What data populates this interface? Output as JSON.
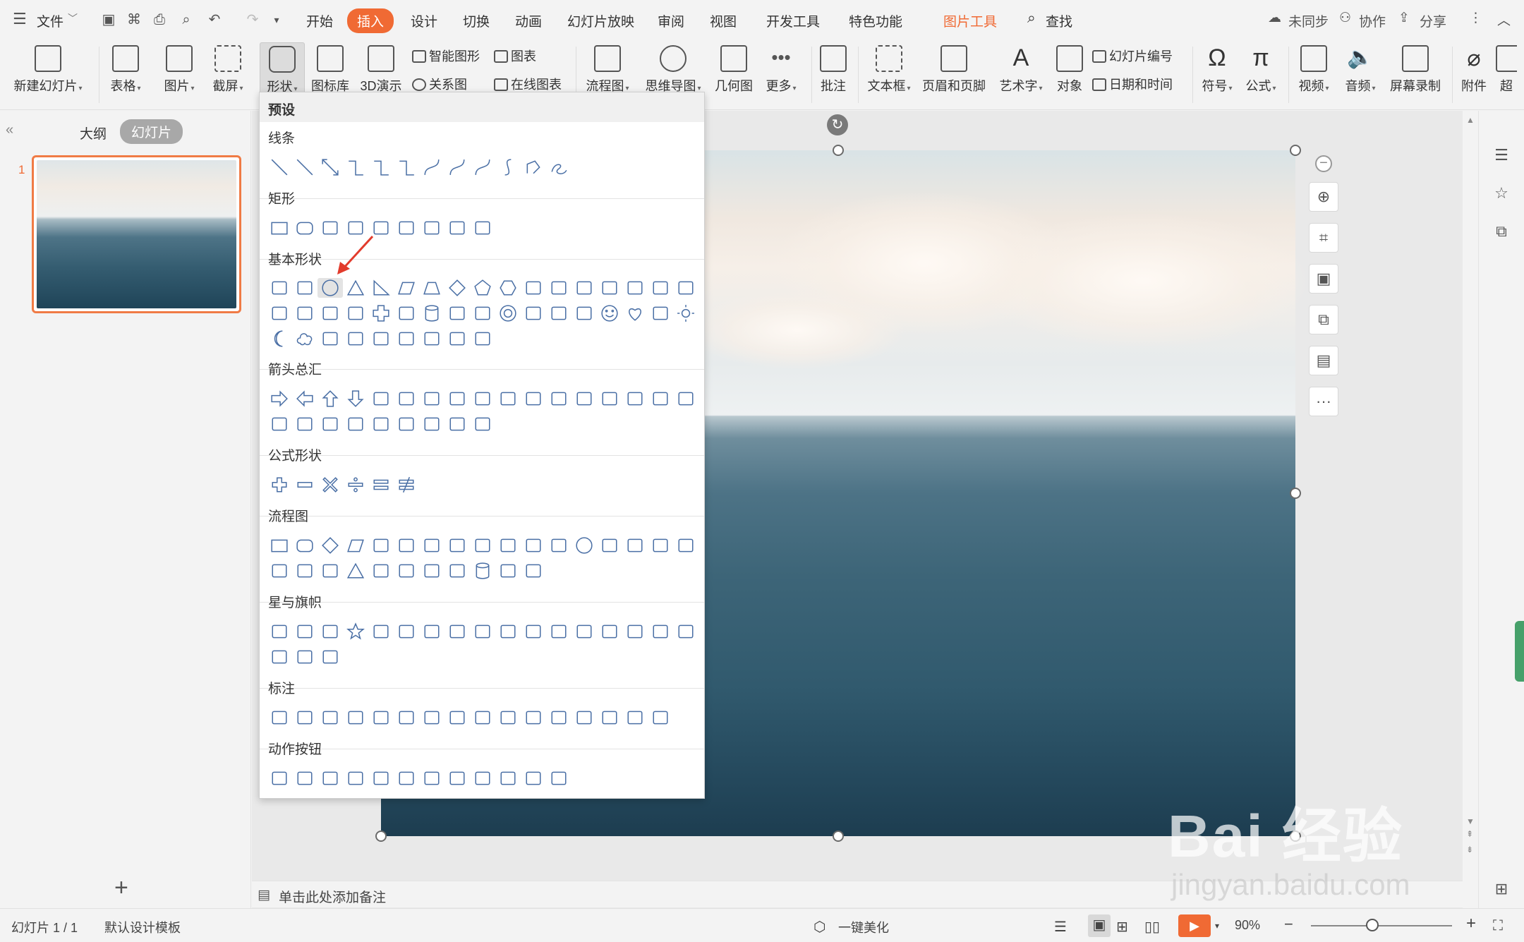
{
  "titlebar": {
    "file_label": "文件",
    "tabs": [
      "开始",
      "插入",
      "设计",
      "切换",
      "动画",
      "幻灯片放映",
      "审阅",
      "视图",
      "开发工具",
      "特色功能"
    ],
    "context_tab": "图片工具",
    "search": "查找",
    "sync": "未同步",
    "collab": "协作",
    "share": "分享"
  },
  "ribbon": {
    "new_slide": "新建幻灯片",
    "table": "表格",
    "picture": "图片",
    "screenshot": "截屏",
    "shape": "形状",
    "icon_lib": "图标库",
    "demo3d": "3D演示",
    "smart_graphic": "智能图形",
    "chart": "图表",
    "relation": "关系图",
    "online_chart": "在线图表",
    "flowchart": "流程图",
    "mindmap": "思维导图",
    "geometry": "几何图",
    "more": "更多",
    "comment": "批注",
    "textbox": "文本框",
    "header_footer": "页眉和页脚",
    "wordart": "艺术字",
    "object": "对象",
    "slide_number": "幻灯片编号",
    "date_time": "日期和时间",
    "symbol": "符号",
    "formula": "公式",
    "video": "视频",
    "audio": "音频",
    "screen_record": "屏幕录制",
    "attachment": "附件",
    "super": "超"
  },
  "left_pane": {
    "outline_tab": "大纲",
    "slides_tab": "幻灯片",
    "slide_number": "1"
  },
  "shape_panel": {
    "preset": "预设",
    "sections": {
      "lines": "线条",
      "rect": "矩形",
      "basic": "基本形状",
      "arrows": "箭头总汇",
      "formula": "公式形状",
      "flowchart": "流程图",
      "stars": "星与旗帜",
      "callouts": "标注",
      "action": "动作按钮"
    }
  },
  "notes": {
    "placeholder": "单击此处添加备注"
  },
  "status": {
    "slide_info": "幻灯片 1 / 1",
    "template": "默认设计模板",
    "beautify": "一键美化",
    "zoom": "90%"
  },
  "watermark": {
    "brand": "Bai 经验",
    "url": "jingyan.baidu.com"
  },
  "colors": {
    "accent": "#f06a34",
    "shape_stroke": "#4a6fa5"
  }
}
